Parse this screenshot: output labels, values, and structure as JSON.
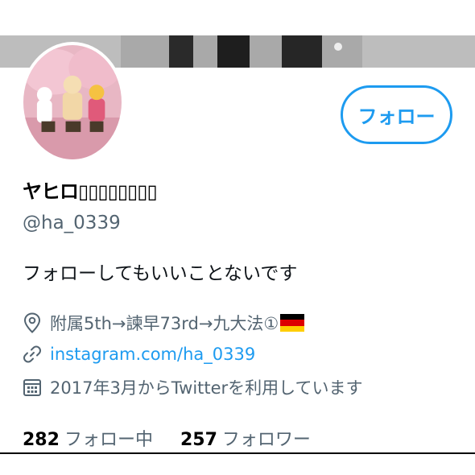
{
  "profile": {
    "display_name": "ヤヒロ▯▯▯▯▯▯▯▯",
    "handle": "@ha_0339",
    "bio": "フォローしてもいいことないです"
  },
  "actions": {
    "follow_label": "フォロー"
  },
  "meta": {
    "location": "附属5th→諫早73rd→九大法①",
    "website": "instagram.com/ha_0339",
    "joined": "2017年3月からTwitterを利用しています"
  },
  "stats": {
    "following_count": "282",
    "following_label": "フォロー中",
    "followers_count": "257",
    "followers_label": "フォロワー"
  },
  "icons": {
    "location": "location-pin-icon",
    "website": "link-icon",
    "joined": "calendar-icon",
    "flag": "germany-flag-icon"
  },
  "colors": {
    "accent": "#1d9bf0",
    "secondary_text": "#536471",
    "primary_text": "#0f1419"
  }
}
